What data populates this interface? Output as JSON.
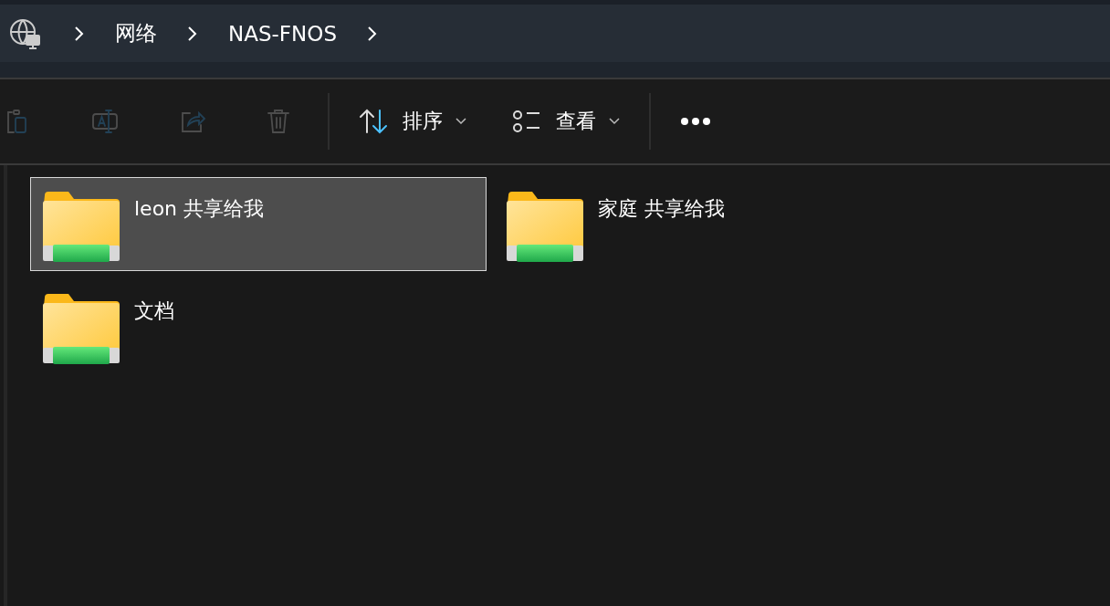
{
  "breadcrumb": [
    {
      "label": "网络"
    },
    {
      "label": "NAS-FNOS"
    }
  ],
  "toolbar": {
    "actions": [
      {
        "kind": "paste",
        "disabled": true
      },
      {
        "kind": "rename",
        "disabled": true
      },
      {
        "kind": "share",
        "disabled": true
      },
      {
        "kind": "delete",
        "disabled": true
      }
    ],
    "menus": [
      {
        "kind": "sort",
        "label": "排序"
      },
      {
        "kind": "view",
        "label": "查看"
      }
    ]
  },
  "folders": [
    {
      "name": "leon 共享给我",
      "selected": true
    },
    {
      "name": "家庭 共享给我",
      "selected": false
    },
    {
      "name": "文档",
      "selected": false
    }
  ]
}
